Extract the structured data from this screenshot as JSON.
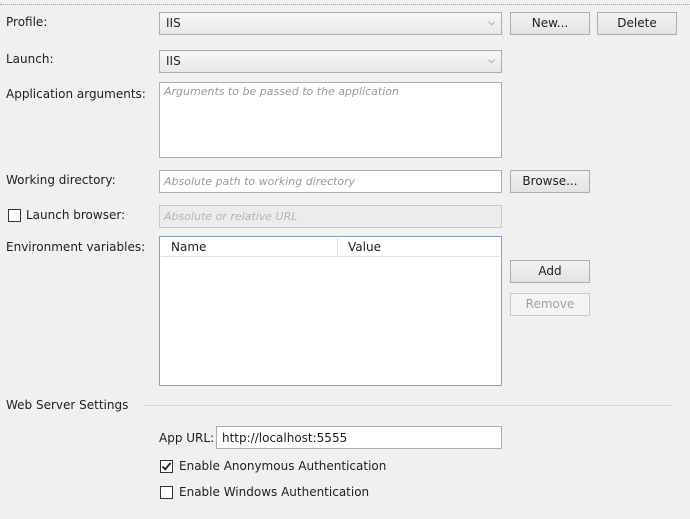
{
  "profile": {
    "label": "Profile:",
    "value": "IIS",
    "new_label": "New...",
    "delete_label": "Delete"
  },
  "launch": {
    "label": "Launch:",
    "value": "IIS"
  },
  "app_args": {
    "label": "Application arguments:",
    "placeholder": "Arguments to be passed to the application",
    "value": ""
  },
  "working_dir": {
    "label": "Working directory:",
    "placeholder": "Absolute path to working directory",
    "value": "",
    "browse_label": "Browse..."
  },
  "launch_browser": {
    "label": "Launch browser:",
    "checked": false,
    "placeholder": "Absolute or relative URL"
  },
  "env_vars": {
    "label": "Environment variables:",
    "columns": [
      "Name",
      "Value"
    ],
    "rows": [],
    "add_label": "Add",
    "remove_label": "Remove"
  },
  "web_server": {
    "section_title": "Web Server Settings",
    "app_url_label": "App URL:",
    "app_url_value": "http://localhost:5555",
    "anon_auth_label": "Enable Anonymous Authentication",
    "anon_auth_checked": true,
    "windows_auth_label": "Enable Windows Authentication",
    "windows_auth_checked": false
  },
  "icons": {
    "dropdown": "chevron-down-icon",
    "check": "checkmark-icon"
  }
}
